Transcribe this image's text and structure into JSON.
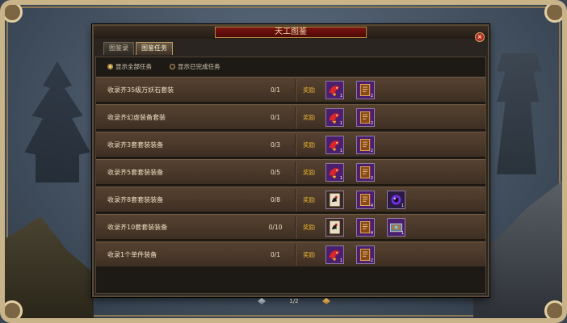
{
  "window": {
    "title": "天工图鉴",
    "close_symbol": "×"
  },
  "tabs": [
    {
      "label": "图鉴录",
      "active": false
    },
    {
      "label": "图鉴任务",
      "active": true
    }
  ],
  "filters": [
    {
      "label": "显示全部任务",
      "selected": true
    },
    {
      "label": "显示已完成任务",
      "selected": false
    }
  ],
  "reward_label": "奖励",
  "tasks": [
    {
      "name": "收录齐35级万妖石套装",
      "progress": "0/1",
      "rewards": [
        {
          "icon": "red-bird-icon",
          "count": "1"
        },
        {
          "icon": "book-icon",
          "count": "2"
        }
      ]
    },
    {
      "name": "收录齐幻虚装备套装",
      "progress": "0/1",
      "rewards": [
        {
          "icon": "red-bird-icon",
          "count": "1"
        },
        {
          "icon": "book-icon",
          "count": "2"
        }
      ]
    },
    {
      "name": "收录齐3套套装装备",
      "progress": "0/3",
      "rewards": [
        {
          "icon": "red-bird-icon",
          "count": "1"
        },
        {
          "icon": "book-icon",
          "count": "2"
        }
      ]
    },
    {
      "name": "收录齐5套套装装备",
      "progress": "0/5",
      "rewards": [
        {
          "icon": "red-bird-icon",
          "count": "1"
        },
        {
          "icon": "book-icon",
          "count": "2"
        }
      ]
    },
    {
      "name": "收录齐8套套装装备",
      "progress": "0/8",
      "rewards": [
        {
          "icon": "scroll-bird-icon",
          "count": ""
        },
        {
          "icon": "book-icon",
          "count": "4"
        },
        {
          "icon": "purple-orb-icon",
          "count": "1"
        }
      ]
    },
    {
      "name": "收录齐10套套装装备",
      "progress": "0/10",
      "rewards": [
        {
          "icon": "scroll-bird-icon",
          "count": ""
        },
        {
          "icon": "book-icon",
          "count": "4"
        },
        {
          "icon": "gem-box-icon",
          "count": "1"
        }
      ]
    },
    {
      "name": "收录1个单件装备",
      "progress": "0/1",
      "rewards": [
        {
          "icon": "red-bird-icon",
          "count": "1"
        },
        {
          "icon": "book-icon",
          "count": "2"
        }
      ]
    }
  ],
  "pager": {
    "page_text": "1/2"
  },
  "colors": {
    "title_plate": "#7a1410",
    "reward_text": "#e6b430",
    "row_bg": "#574231"
  }
}
